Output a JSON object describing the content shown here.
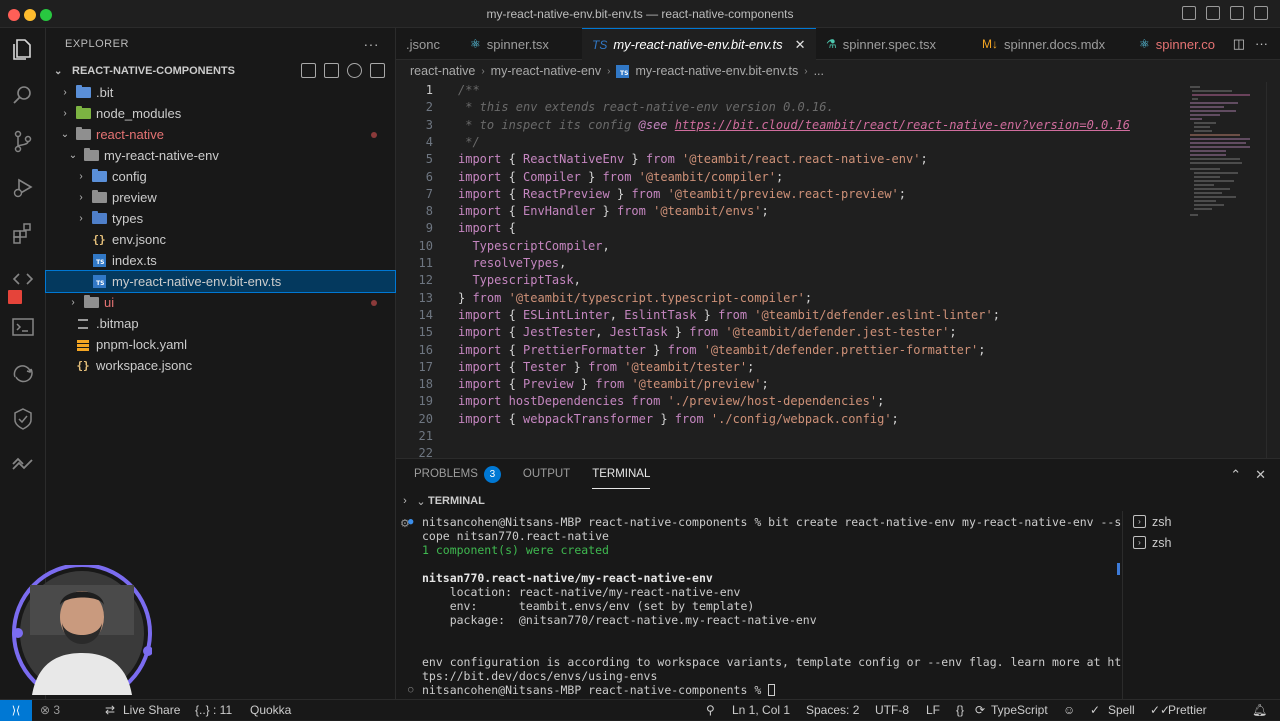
{
  "window": {
    "title": "my-react-native-env.bit-env.ts — react-native-components"
  },
  "explorer": {
    "header": "EXPLORER",
    "more": "···",
    "section": "REACT-NATIVE-COMPONENTS",
    "items": [
      {
        "label": ".bit",
        "depth": 1,
        "twisty": "›",
        "icon": "folder-bit",
        "color": "#5a8fd8"
      },
      {
        "label": "node_modules",
        "depth": 1,
        "twisty": "›",
        "icon": "folder-node",
        "color": "#7cb342"
      },
      {
        "label": "react-native",
        "depth": 1,
        "twisty": "⌄",
        "icon": "folder-open",
        "color": "#8f8f8f",
        "text_color": "#e57373",
        "dot": true
      },
      {
        "label": "my-react-native-env",
        "depth": 2,
        "twisty": "⌄",
        "icon": "folder-open",
        "color": "#8f8f8f"
      },
      {
        "label": "config",
        "depth": 3,
        "twisty": "›",
        "icon": "folder-config",
        "color": "#5a8fd8"
      },
      {
        "label": "preview",
        "depth": 3,
        "twisty": "›",
        "icon": "folder",
        "color": "#8f8f8f"
      },
      {
        "label": "types",
        "depth": 3,
        "twisty": "›",
        "icon": "folder-types",
        "color": "#4f7fc9"
      },
      {
        "label": "env.jsonc",
        "depth": 3,
        "twisty": "",
        "icon": "json",
        "color": "#e5c07b"
      },
      {
        "label": "index.ts",
        "depth": 3,
        "twisty": "",
        "icon": "ts",
        "color": "#3178c6"
      },
      {
        "label": "my-react-native-env.bit-env.ts",
        "depth": 3,
        "twisty": "",
        "icon": "ts",
        "color": "#3178c6",
        "selected": true
      },
      {
        "label": "ui",
        "depth": 2,
        "twisty": "›",
        "icon": "folder",
        "color": "#8f8f8f",
        "text_color": "#e57373",
        "dot": true
      },
      {
        "label": ".bitmap",
        "depth": 1,
        "twisty": "",
        "icon": "file",
        "color": "#9a9a9a"
      },
      {
        "label": "pnpm-lock.yaml",
        "depth": 1,
        "twisty": "",
        "icon": "yaml",
        "color": "#f5a623"
      },
      {
        "label": "workspace.jsonc",
        "depth": 1,
        "twisty": "",
        "icon": "json",
        "color": "#e5c07b"
      }
    ]
  },
  "tabs": [
    {
      "label": ".jsonc",
      "icon": "",
      "active": false
    },
    {
      "label": "spinner.tsx",
      "icon": "⚛",
      "icon_color": "#61dafb",
      "active": false
    },
    {
      "label": "my-react-native-env.bit-env.ts",
      "icon": "TS",
      "icon_color": "#3178c6",
      "active": true,
      "close": "✕"
    },
    {
      "label": "spinner.spec.tsx",
      "icon": "⚗",
      "icon_color": "#4ec9b0",
      "active": false
    },
    {
      "label": "spinner.docs.mdx",
      "icon": "M↓",
      "icon_color": "#f5a623",
      "active": false
    },
    {
      "label": "spinner.co",
      "icon": "⚛",
      "icon_color": "#61dafb",
      "active": false,
      "text_color": "#e57373"
    }
  ],
  "breadcrumb": [
    "react-native",
    "my-react-native-env",
    "my-react-native-env.bit-env.ts",
    "..."
  ],
  "code": {
    "current_line": 1,
    "lines": [
      [
        {
          "t": "/**",
          "c": "cm"
        }
      ],
      [
        {
          "t": " * this env extends react-native-env version 0.0.16.",
          "c": "cm"
        }
      ],
      [
        {
          "t": " * to inspect its config ",
          "c": "cm"
        },
        {
          "t": "@see",
          "c": "tag"
        },
        {
          "t": " ",
          "c": "cm"
        },
        {
          "t": "https://bit.cloud/teambit/react/react-native-env?version=0.0.16",
          "c": "link"
        }
      ],
      [
        {
          "t": " */",
          "c": "cm"
        }
      ],
      [
        {
          "t": "import",
          "c": "kw"
        },
        {
          "t": " { ",
          "c": "p"
        },
        {
          "t": "ReactNativeEnv",
          "c": "id"
        },
        {
          "t": " } ",
          "c": "p"
        },
        {
          "t": "from",
          "c": "kw"
        },
        {
          "t": " ",
          "c": "p"
        },
        {
          "t": "'@teambit/react.react-native-env'",
          "c": "str"
        },
        {
          "t": ";",
          "c": "p"
        }
      ],
      [
        {
          "t": "import",
          "c": "kw"
        },
        {
          "t": " { ",
          "c": "p"
        },
        {
          "t": "Compiler",
          "c": "id"
        },
        {
          "t": " } ",
          "c": "p"
        },
        {
          "t": "from",
          "c": "kw"
        },
        {
          "t": " ",
          "c": "p"
        },
        {
          "t": "'@teambit/compiler'",
          "c": "str"
        },
        {
          "t": ";",
          "c": "p"
        }
      ],
      [
        {
          "t": "import",
          "c": "kw"
        },
        {
          "t": " { ",
          "c": "p"
        },
        {
          "t": "ReactPreview",
          "c": "id"
        },
        {
          "t": " } ",
          "c": "p"
        },
        {
          "t": "from",
          "c": "kw"
        },
        {
          "t": " ",
          "c": "p"
        },
        {
          "t": "'@teambit/preview.react-preview'",
          "c": "str"
        },
        {
          "t": ";",
          "c": "p"
        }
      ],
      [
        {
          "t": "import",
          "c": "kw"
        },
        {
          "t": " { ",
          "c": "p"
        },
        {
          "t": "EnvHandler",
          "c": "id"
        },
        {
          "t": " } ",
          "c": "p"
        },
        {
          "t": "from",
          "c": "kw"
        },
        {
          "t": " ",
          "c": "p"
        },
        {
          "t": "'@teambit/envs'",
          "c": "str"
        },
        {
          "t": ";",
          "c": "p"
        }
      ],
      [
        {
          "t": "import",
          "c": "kw"
        },
        {
          "t": " {",
          "c": "p"
        }
      ],
      [
        {
          "t": "  ",
          "c": "p"
        },
        {
          "t": "TypescriptCompiler",
          "c": "id"
        },
        {
          "t": ",",
          "c": "p"
        }
      ],
      [
        {
          "t": "  ",
          "c": "p"
        },
        {
          "t": "resolveTypes",
          "c": "id"
        },
        {
          "t": ",",
          "c": "p"
        }
      ],
      [
        {
          "t": "  ",
          "c": "p"
        },
        {
          "t": "TypescriptTask",
          "c": "id"
        },
        {
          "t": ",",
          "c": "p"
        }
      ],
      [
        {
          "t": "} ",
          "c": "p"
        },
        {
          "t": "from",
          "c": "kw"
        },
        {
          "t": " ",
          "c": "p"
        },
        {
          "t": "'@teambit/typescript.typescript-compiler'",
          "c": "str"
        },
        {
          "t": ";",
          "c": "p"
        }
      ],
      [
        {
          "t": "import",
          "c": "kw"
        },
        {
          "t": " { ",
          "c": "p"
        },
        {
          "t": "ESLintLinter",
          "c": "id"
        },
        {
          "t": ", ",
          "c": "p"
        },
        {
          "t": "EslintTask",
          "c": "id"
        },
        {
          "t": " } ",
          "c": "p"
        },
        {
          "t": "from",
          "c": "kw"
        },
        {
          "t": " ",
          "c": "p"
        },
        {
          "t": "'@teambit/defender.eslint-linter'",
          "c": "str"
        },
        {
          "t": ";",
          "c": "p"
        }
      ],
      [
        {
          "t": "import",
          "c": "kw"
        },
        {
          "t": " { ",
          "c": "p"
        },
        {
          "t": "JestTester",
          "c": "id"
        },
        {
          "t": ", ",
          "c": "p"
        },
        {
          "t": "JestTask",
          "c": "id"
        },
        {
          "t": " } ",
          "c": "p"
        },
        {
          "t": "from",
          "c": "kw"
        },
        {
          "t": " ",
          "c": "p"
        },
        {
          "t": "'@teambit/defender.jest-tester'",
          "c": "str"
        },
        {
          "t": ";",
          "c": "p"
        }
      ],
      [
        {
          "t": "import",
          "c": "kw"
        },
        {
          "t": " { ",
          "c": "p"
        },
        {
          "t": "PrettierFormatter",
          "c": "id"
        },
        {
          "t": " } ",
          "c": "p"
        },
        {
          "t": "from",
          "c": "kw"
        },
        {
          "t": " ",
          "c": "p"
        },
        {
          "t": "'@teambit/defender.prettier-formatter'",
          "c": "str"
        },
        {
          "t": ";",
          "c": "p"
        }
      ],
      [
        {
          "t": "import",
          "c": "kw"
        },
        {
          "t": " { ",
          "c": "p"
        },
        {
          "t": "Tester",
          "c": "id"
        },
        {
          "t": " } ",
          "c": "p"
        },
        {
          "t": "from",
          "c": "kw"
        },
        {
          "t": " ",
          "c": "p"
        },
        {
          "t": "'@teambit/tester'",
          "c": "str"
        },
        {
          "t": ";",
          "c": "p"
        }
      ],
      [
        {
          "t": "import",
          "c": "kw"
        },
        {
          "t": " { ",
          "c": "p"
        },
        {
          "t": "Preview",
          "c": "id"
        },
        {
          "t": " } ",
          "c": "p"
        },
        {
          "t": "from",
          "c": "kw"
        },
        {
          "t": " ",
          "c": "p"
        },
        {
          "t": "'@teambit/preview'",
          "c": "str"
        },
        {
          "t": ";",
          "c": "p"
        }
      ],
      [
        {
          "t": "import",
          "c": "kw"
        },
        {
          "t": " ",
          "c": "p"
        },
        {
          "t": "hostDependencies",
          "c": "id"
        },
        {
          "t": " ",
          "c": "p"
        },
        {
          "t": "from",
          "c": "kw"
        },
        {
          "t": " ",
          "c": "p"
        },
        {
          "t": "'./preview/host-dependencies'",
          "c": "str"
        },
        {
          "t": ";",
          "c": "p"
        }
      ],
      [
        {
          "t": "import",
          "c": "kw"
        },
        {
          "t": " { ",
          "c": "p"
        },
        {
          "t": "webpackTransformer",
          "c": "id"
        },
        {
          "t": " } ",
          "c": "p"
        },
        {
          "t": "from",
          "c": "kw"
        },
        {
          "t": " ",
          "c": "p"
        },
        {
          "t": "'./config/webpack.config'",
          "c": "str"
        },
        {
          "t": ";",
          "c": "p"
        }
      ],
      [],
      []
    ],
    "colors": {
      "cm": "#6a6a6a",
      "tag": "#c586c0",
      "link": "#d16d9e",
      "kw": "#c586c0",
      "p": "#d4d4d4",
      "id": "#c586c0",
      "str": "#ce9178"
    }
  },
  "panel": {
    "tabs": [
      {
        "label": "PROBLEMS",
        "badge": "3",
        "active": false
      },
      {
        "label": "OUTPUT",
        "active": false
      },
      {
        "label": "TERMINAL",
        "active": true
      }
    ],
    "terminal_header": "TERMINAL",
    "terminal_lines": [
      {
        "t": "nitsancohen@Nitsans-MBP react-native-components % bit create react-native-env my-react-native-env --s",
        "c": "#cccccc",
        "mark": true
      },
      {
        "t": "cope nitsan770.react-native",
        "c": "#cccccc"
      },
      {
        "t": "1 component(s) were created",
        "c": "#3fb950"
      },
      {
        "t": "",
        "c": "#cccccc"
      },
      {
        "t": "nitsan770.react-native/my-react-native-env",
        "c": "#e5e5e5",
        "bold": true
      },
      {
        "t": "    location: react-native/my-react-native-env",
        "c": "#cccccc"
      },
      {
        "t": "    env:      teambit.envs/env (set by template)",
        "c": "#cccccc"
      },
      {
        "t": "    package:  @nitsan770/react-native.my-react-native-env",
        "c": "#cccccc"
      },
      {
        "t": "",
        "c": "#cccccc"
      },
      {
        "t": "",
        "c": "#cccccc"
      },
      {
        "t": "env configuration is according to workspace variants, template config or --env flag. learn more at ht",
        "c": "#cccccc"
      },
      {
        "t": "tps://bit.dev/docs/envs/using-envs",
        "c": "#cccccc"
      },
      {
        "t": "nitsancohen@Nitsans-MBP react-native-components % ",
        "c": "#cccccc",
        "mark": true,
        "cursor": true
      }
    ],
    "terminals": [
      "zsh",
      "zsh"
    ]
  },
  "status": {
    "remote": "⟩⟨",
    "errors": "⊗ 3",
    "live_share": "Live Share",
    "braces": "{..} : 11",
    "quokka": "Quokka",
    "position": "Ln 1, Col 1",
    "spaces": "Spaces: 2",
    "encoding": "UTF-8",
    "eol": "LF",
    "language": "TypeScript",
    "spell": "Spell",
    "prettier": "Prettier"
  }
}
